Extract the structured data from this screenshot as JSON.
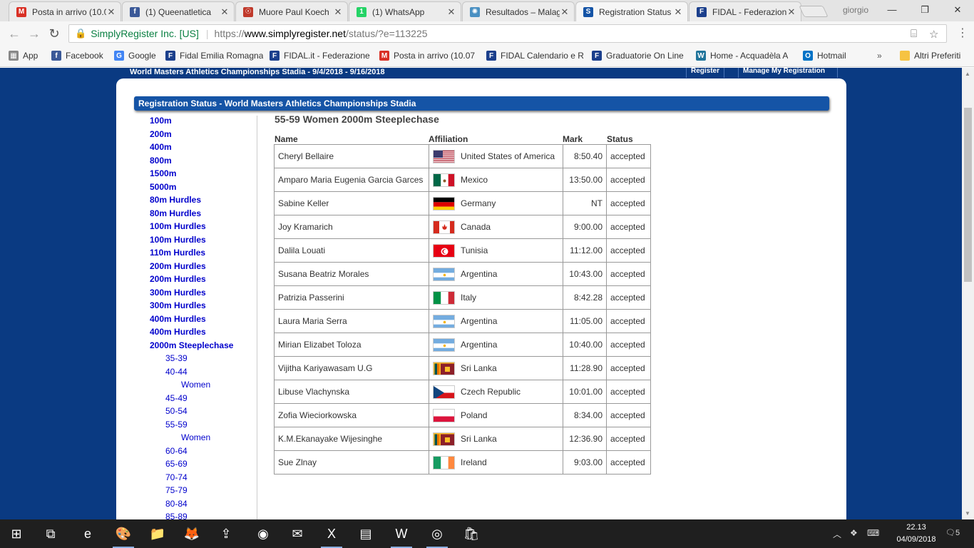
{
  "browser": {
    "tabs": [
      {
        "title": "Posta in arrivo (10.0",
        "icon": "gmail-icon",
        "color": "#d93025",
        "glyph": "M",
        "active": false
      },
      {
        "title": "(1) Queenatletica",
        "icon": "facebook-icon",
        "color": "#3b5998",
        "glyph": "f",
        "active": false
      },
      {
        "title": "Muore Paul Koech",
        "icon": "site-icon",
        "color": "#c0392b",
        "glyph": "☉",
        "active": false
      },
      {
        "title": "(1) WhatsApp",
        "icon": "whatsapp-icon",
        "color": "#25d366",
        "glyph": "1",
        "active": false
      },
      {
        "title": "Resultados – Malag",
        "icon": "site-icon",
        "color": "#4a90c2",
        "glyph": "✺",
        "active": false
      },
      {
        "title": "Registration Status",
        "icon": "simplyregister-icon",
        "color": "#1554a6",
        "glyph": "S",
        "active": true
      },
      {
        "title": "FIDAL - Federazion",
        "icon": "fidal-icon",
        "color": "#1b3f8c",
        "glyph": "F",
        "active": false
      }
    ],
    "profile_name": "giorgio",
    "address": {
      "secure_label": "SimplyRegister Inc. [US]",
      "url_scheme": "https://",
      "url_host": "www.simplyregister.net",
      "url_path": "/status/?e=113225"
    },
    "bookmarks": [
      {
        "label": "App",
        "icon": "apps-grid-icon",
        "color": "#888",
        "glyph": "▦"
      },
      {
        "label": "Facebook",
        "icon": "facebook-icon",
        "color": "#3b5998",
        "glyph": "f"
      },
      {
        "label": "Google",
        "icon": "google-icon",
        "color": "#4285f4",
        "glyph": "G"
      },
      {
        "label": "Fidal Emilia Romagna",
        "icon": "fidal-icon",
        "color": "#1b3f8c",
        "glyph": "F"
      },
      {
        "label": "FIDAL.it - Federazione",
        "icon": "fidal-icon",
        "color": "#1b3f8c",
        "glyph": "F"
      },
      {
        "label": "Posta in arrivo (10.07",
        "icon": "gmail-icon",
        "color": "#d93025",
        "glyph": "M"
      },
      {
        "label": "FIDAL Calendario e R",
        "icon": "fidal-icon",
        "color": "#1b3f8c",
        "glyph": "F"
      },
      {
        "label": "Graduatorie On Line",
        "icon": "fidal-icon",
        "color": "#1b3f8c",
        "glyph": "F"
      },
      {
        "label": "Home - Acquadèla A",
        "icon": "wordpress-icon",
        "color": "#21759b",
        "glyph": "W"
      },
      {
        "label": "Hotmail",
        "icon": "outlook-icon",
        "color": "#0072c6",
        "glyph": "O"
      }
    ],
    "bookmarks_overflow": "»",
    "other_bookmarks": "Altri Preferiti"
  },
  "page": {
    "event_header": "World Masters Athletics Championships Stadia - 9/4/2018 - 9/16/2018",
    "register_button": "Register",
    "manage_button": "Manage My Registration",
    "panel_title": "Registration Status - World Masters Athletics Championships Stadia",
    "event_title": "55-59 Women 2000m Steeplechase",
    "columns": {
      "name": "Name",
      "affiliation": "Affiliation",
      "mark": "Mark",
      "status": "Status"
    },
    "nav": [
      {
        "label": "100m",
        "level": 1
      },
      {
        "label": "200m",
        "level": 1
      },
      {
        "label": "400m",
        "level": 1
      },
      {
        "label": "800m",
        "level": 1
      },
      {
        "label": "1500m",
        "level": 1
      },
      {
        "label": "5000m",
        "level": 1
      },
      {
        "label": "80m Hurdles",
        "level": 1
      },
      {
        "label": "80m Hurdles",
        "level": 1
      },
      {
        "label": "100m Hurdles",
        "level": 1
      },
      {
        "label": "100m Hurdles",
        "level": 1
      },
      {
        "label": "110m Hurdles",
        "level": 1
      },
      {
        "label": "200m Hurdles",
        "level": 1
      },
      {
        "label": "200m Hurdles",
        "level": 1
      },
      {
        "label": "300m Hurdles",
        "level": 1
      },
      {
        "label": "300m Hurdles",
        "level": 1
      },
      {
        "label": "400m Hurdles",
        "level": 1
      },
      {
        "label": "400m Hurdles",
        "level": 1
      },
      {
        "label": "2000m Steeplechase",
        "level": 1
      },
      {
        "label": "35-39",
        "level": 2
      },
      {
        "label": "40-44",
        "level": 2
      },
      {
        "label": "Women",
        "level": 3
      },
      {
        "label": "45-49",
        "level": 2
      },
      {
        "label": "50-54",
        "level": 2
      },
      {
        "label": "55-59",
        "level": 2
      },
      {
        "label": "Women",
        "level": 3
      },
      {
        "label": "60-64",
        "level": 2
      },
      {
        "label": "65-69",
        "level": 2
      },
      {
        "label": "70-74",
        "level": 2
      },
      {
        "label": "75-79",
        "level": 2
      },
      {
        "label": "80-84",
        "level": 2
      },
      {
        "label": "85-89",
        "level": 2
      }
    ],
    "results": [
      {
        "name": "Cheryl Bellaire",
        "country": "United States of America",
        "flag": "usa",
        "mark": "8:50.40",
        "status": "accepted"
      },
      {
        "name": "Amparo Maria Eugenia Garcia Garces",
        "country": "Mexico",
        "flag": "mexico",
        "mark": "13:50.00",
        "status": "accepted"
      },
      {
        "name": "Sabine Keller",
        "country": "Germany",
        "flag": "germany",
        "mark": "NT",
        "status": "accepted"
      },
      {
        "name": "Joy Kramarich",
        "country": "Canada",
        "flag": "canada",
        "mark": "9:00.00",
        "status": "accepted"
      },
      {
        "name": "Dalila Louati",
        "country": "Tunisia",
        "flag": "tunisia",
        "mark": "11:12.00",
        "status": "accepted"
      },
      {
        "name": "Susana Beatriz Morales",
        "country": "Argentina",
        "flag": "argentina",
        "mark": "10:43.00",
        "status": "accepted"
      },
      {
        "name": "Patrizia Passerini",
        "country": "Italy",
        "flag": "italy",
        "mark": "8:42.28",
        "status": "accepted"
      },
      {
        "name": "Laura Maria Serra",
        "country": "Argentina",
        "flag": "argentina",
        "mark": "11:05.00",
        "status": "accepted"
      },
      {
        "name": "Mirian Elizabet Toloza",
        "country": "Argentina",
        "flag": "argentina",
        "mark": "10:40.00",
        "status": "accepted"
      },
      {
        "name": "Vijitha Kariyawasam U.G",
        "country": "Sri Lanka",
        "flag": "srilanka",
        "mark": "11:28.90",
        "status": "accepted"
      },
      {
        "name": "Libuse Vlachynska",
        "country": "Czech Republic",
        "flag": "czech",
        "mark": "10:01.00",
        "status": "accepted"
      },
      {
        "name": "Zofia Wieciorkowska",
        "country": "Poland",
        "flag": "poland",
        "mark": "8:34.00",
        "status": "accepted"
      },
      {
        "name": "K.M.Ekanayake Wijesinghe",
        "country": "Sri Lanka",
        "flag": "srilanka",
        "mark": "12:36.90",
        "status": "accepted"
      },
      {
        "name": "Sue Zlnay",
        "country": "Ireland",
        "flag": "ireland",
        "mark": "9:03.00",
        "status": "accepted"
      }
    ]
  },
  "taskbar": {
    "apps": [
      {
        "icon": "windows-start-icon",
        "glyph": "⊞",
        "open": false
      },
      {
        "icon": "task-view-icon",
        "glyph": "⧉",
        "open": false
      },
      {
        "icon": "edge-icon",
        "glyph": "e",
        "open": false
      },
      {
        "icon": "paint-icon",
        "glyph": "🎨",
        "open": true
      },
      {
        "icon": "file-explorer-icon",
        "glyph": "📁",
        "open": false
      },
      {
        "icon": "firefox-icon",
        "glyph": "🦊",
        "open": false
      },
      {
        "icon": "upload-app-icon",
        "glyph": "⇪",
        "open": false
      },
      {
        "icon": "photos-app-icon",
        "glyph": "◉",
        "open": false
      },
      {
        "icon": "mail-icon",
        "glyph": "✉",
        "open": false
      },
      {
        "icon": "excel-icon",
        "glyph": "X",
        "open": true
      },
      {
        "icon": "document-app-icon",
        "glyph": "▤",
        "open": false
      },
      {
        "icon": "word-icon",
        "glyph": "W",
        "open": true
      },
      {
        "icon": "chrome-icon",
        "glyph": "◎",
        "open": true
      },
      {
        "icon": "store-icon",
        "glyph": "🛍",
        "open": false
      }
    ],
    "time": "22.13",
    "date": "04/09/2018",
    "notification_count": "5"
  }
}
